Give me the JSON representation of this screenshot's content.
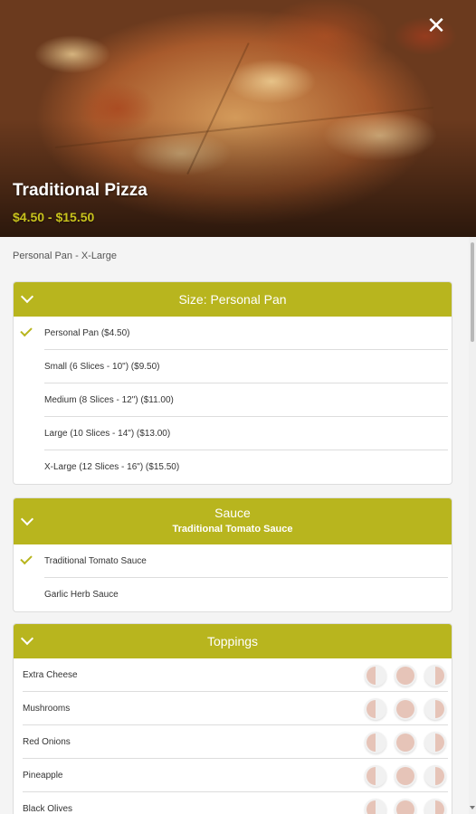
{
  "item": {
    "title": "Traditional Pizza",
    "price_range": "$4.50 - $15.50",
    "size_range": "Personal Pan - X-Large"
  },
  "icons": {
    "close": "close-icon",
    "expand": "chevron-down-icon",
    "selected": "check-icon"
  },
  "colors": {
    "accent": "#b8b51e",
    "price": "#c8c21c",
    "topping_fill": "#e6c4b8"
  },
  "size_group": {
    "title": "Size: Personal Pan",
    "options": [
      {
        "label": "Personal Pan ($4.50)",
        "selected": true
      },
      {
        "label": "Small (6 Slices - 10\") ($9.50)",
        "selected": false
      },
      {
        "label": "Medium (8 Slices - 12\") ($11.00)",
        "selected": false
      },
      {
        "label": "Large (10 Slices - 14\") ($13.00)",
        "selected": false
      },
      {
        "label": "X-Large (12 Slices - 16\") ($15.50)",
        "selected": false
      }
    ]
  },
  "sauce_group": {
    "title": "Sauce",
    "subtitle": "Traditional Tomato Sauce",
    "options": [
      {
        "label": "Traditional Tomato Sauce",
        "selected": true
      },
      {
        "label": "Garlic Herb Sauce",
        "selected": false
      }
    ]
  },
  "toppings_group": {
    "title": "Toppings",
    "items": [
      {
        "label": "Extra Cheese"
      },
      {
        "label": "Mushrooms"
      },
      {
        "label": "Red Onions"
      },
      {
        "label": "Pineapple"
      },
      {
        "label": "Black Olives"
      }
    ]
  }
}
